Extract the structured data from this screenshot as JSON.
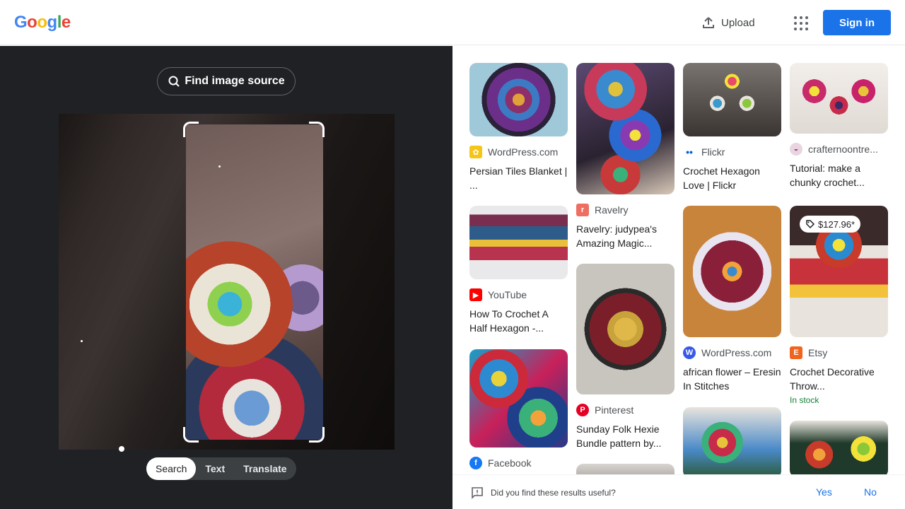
{
  "header": {
    "logo": [
      "G",
      "o",
      "o",
      "g",
      "l",
      "e"
    ],
    "logo_colors": [
      "#4285f4",
      "#ea4335",
      "#fbbc05",
      "#4285f4",
      "#34a853",
      "#ea4335"
    ],
    "upload_label": "Upload",
    "apps_icon": "apps-grid-icon",
    "signin_label": "Sign in"
  },
  "lens": {
    "find_source_label": "Find image source",
    "modes": [
      "Search",
      "Text",
      "Translate"
    ],
    "active_mode": "Search"
  },
  "results": [
    {
      "source": "WordPress.com",
      "title": "Persian Tiles Blanket | ...",
      "favicon_color": "#f5c518",
      "favicon": "sunflower-icon"
    },
    {
      "source": "Flickr",
      "title": "Crochet Hexagon Love | Flickr",
      "favicon_color": "#ffffff",
      "favicon": "flickr-icon"
    },
    {
      "source": "crafternoontre...",
      "title": "Tutorial: make a chunky crochet...",
      "favicon_color": "#e8d5e0",
      "favicon": "crafternoon-icon"
    },
    {
      "source": "Ravelry",
      "title": "Ravelry: judypea's Amazing Magic...",
      "favicon_color": "#ee6e62",
      "favicon": "ravelry-icon"
    },
    {
      "source": "YouTube",
      "title": "How To Crochet A Half Hexagon -...",
      "favicon_color": "#ff0000",
      "favicon": "youtube-icon"
    },
    {
      "source": "WordPress.com",
      "title": "african flower – Eresin In Stitches",
      "favicon_color": "#3858e9",
      "favicon": "wordpress-icon"
    },
    {
      "source": "Etsy",
      "title": "Crochet Decorative Throw...",
      "price": "$127.96*",
      "stock": "In stock",
      "favicon_color": "#f1641e",
      "favicon": "etsy-icon"
    },
    {
      "source": "Pinterest",
      "title": "Sunday Folk Hexie Bundle pattern by...",
      "favicon_color": "#e60023",
      "favicon": "pinterest-icon"
    },
    {
      "source": "Facebook",
      "title": "",
      "favicon_color": "#1877f2",
      "favicon": "facebook-icon"
    }
  ],
  "feedback": {
    "question": "Did you find these results useful?",
    "yes": "Yes",
    "no": "No"
  }
}
